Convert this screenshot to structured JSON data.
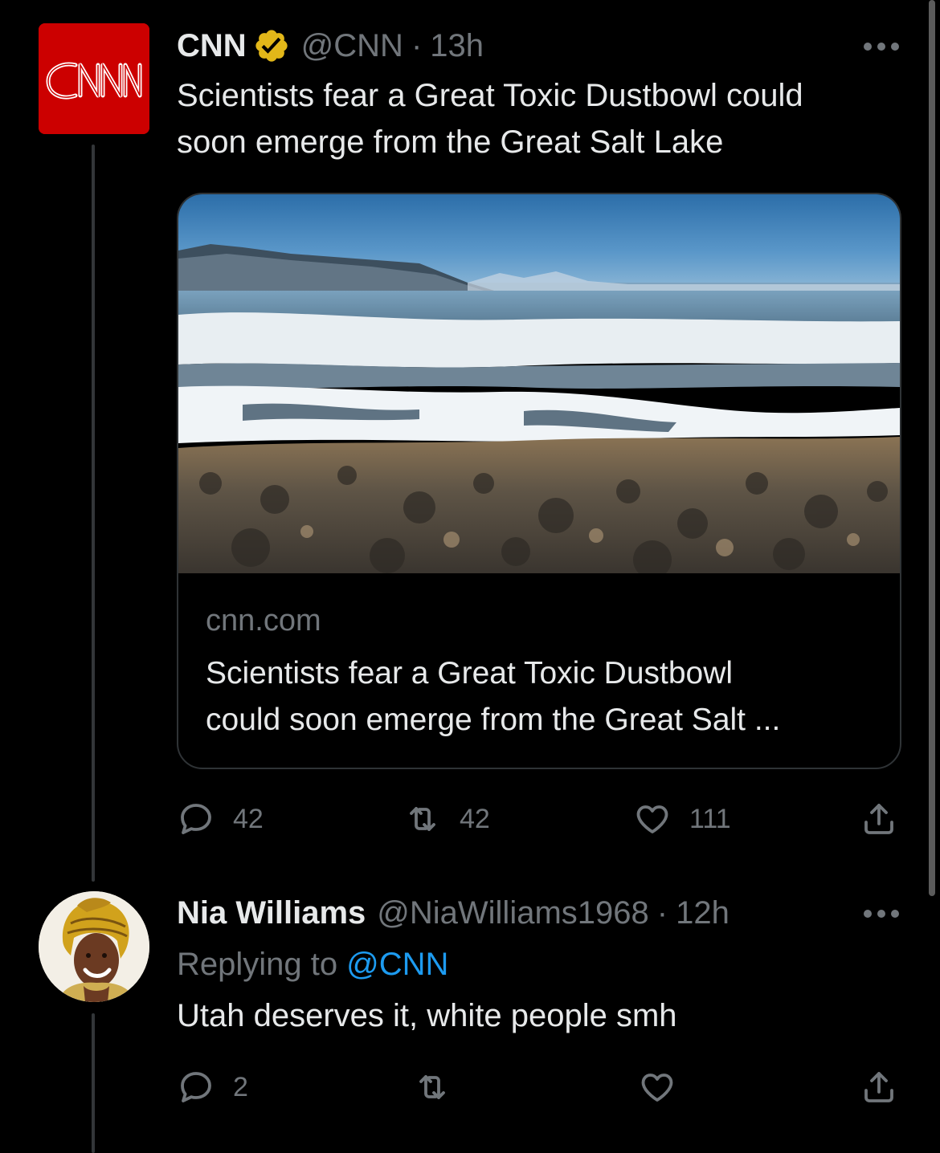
{
  "tweet": {
    "display_name": "CNN",
    "verified_badge": "verified-gold-badge",
    "handle": "@CNN",
    "separator": "·",
    "time": "13h",
    "text_line1": "Scientists fear a Great Toxic Dustbowl could",
    "text_line2": "soon emerge from the Great Salt Lake",
    "avatar_logo_text": "CNN",
    "card": {
      "domain": "cnn.com",
      "title_line1": "Scientists fear a Great Toxic Dustbowl",
      "title_line2": "could soon emerge from the Great Salt ..."
    },
    "actions": {
      "replies": "42",
      "retweets": "42",
      "likes": "111"
    }
  },
  "reply": {
    "display_name": "Nia Williams",
    "handle": "@NiaWilliams1968",
    "separator": "·",
    "time": "12h",
    "replying_prefix": "Replying to",
    "replying_mention": "@CNN",
    "text": "Utah deserves it, white people smh",
    "actions": {
      "replies": "2"
    }
  },
  "colors": {
    "background": "#000000",
    "text_primary": "#e7e9ea",
    "text_secondary": "#71767b",
    "link": "#1d9bf0",
    "cnn_red": "#cc0000",
    "verified_gold": "#e2b719"
  }
}
